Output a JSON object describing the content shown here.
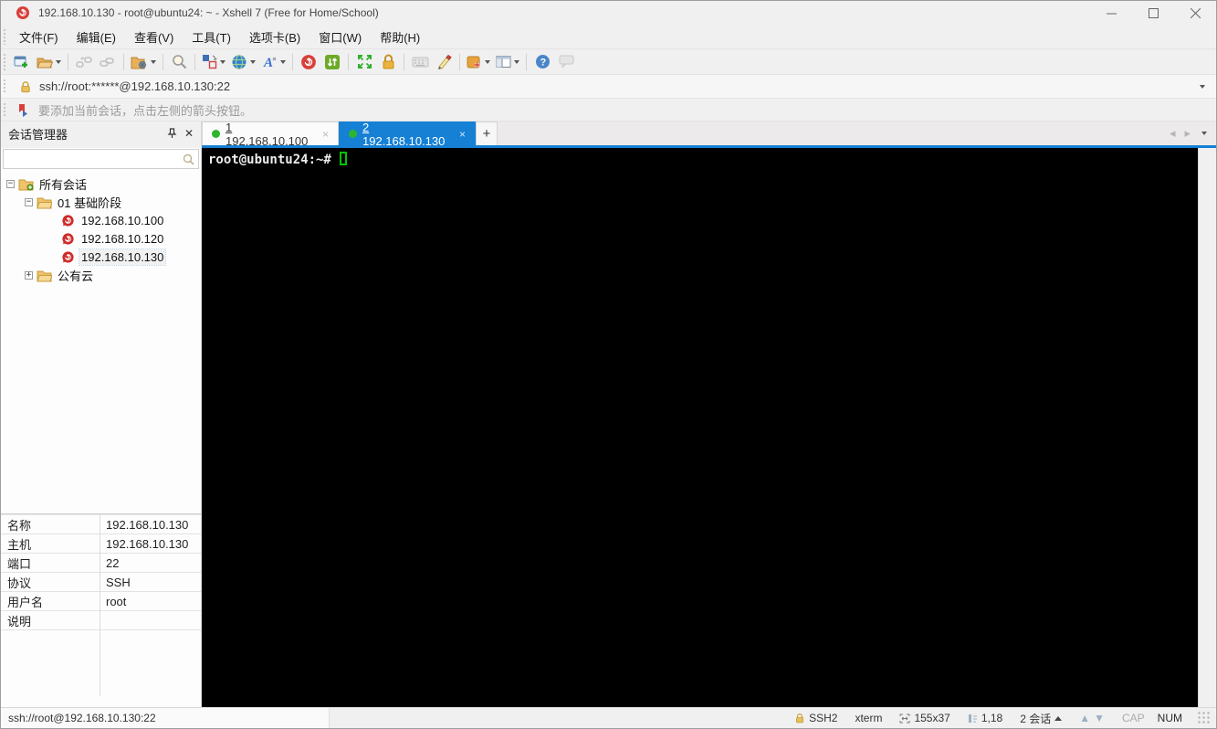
{
  "window": {
    "title": "192.168.10.130 - root@ubuntu24: ~ - Xshell 7 (Free for Home/School)",
    "controls": {
      "minimize": "—",
      "maximize": "□",
      "close": "✕"
    }
  },
  "menu": {
    "items": [
      "文件(F)",
      "编辑(E)",
      "查看(V)",
      "工具(T)",
      "选项卡(B)",
      "窗口(W)",
      "帮助(H)"
    ]
  },
  "toolbar": {
    "icons": [
      "new-session-icon",
      "open-folder-icon",
      "disconnect-icon",
      "reconnect-icon",
      "session-properties-icon",
      "find-icon",
      "arrange-icon",
      "web-browser-icon",
      "font-icon",
      "xshell-app-icon",
      "xftp-app-icon",
      "fullscreen-icon",
      "lock-icon",
      "virtual-keyboard-icon",
      "highlight-pen-icon",
      "new-layout-icon",
      "tile-layout-icon",
      "help-icon",
      "feedback-icon"
    ]
  },
  "address_bar": {
    "value": "ssh://root:******@192.168.10.130:22"
  },
  "info_bar": {
    "text": "要添加当前会话，点击左侧的箭头按钮。"
  },
  "tabs": {
    "items": [
      {
        "index": "1",
        "host": "192.168.10.100",
        "close": "×",
        "active": false
      },
      {
        "index": "2",
        "host": "192.168.10.130",
        "close": "×",
        "active": true
      }
    ],
    "add_label": "+"
  },
  "sidebar": {
    "title": "会话管理器",
    "close": "✕",
    "search": {
      "value": "",
      "placeholder": ""
    },
    "tree": [
      {
        "label": "所有会话",
        "expander": "−",
        "icon": "sessions-root-folder"
      },
      {
        "label": "01 基础阶段",
        "expander": "−",
        "icon": "folder"
      },
      {
        "label": "192.168.10.100",
        "icon": "xshell-session"
      },
      {
        "label": "192.168.10.120",
        "icon": "xshell-session"
      },
      {
        "label": "192.168.10.130",
        "icon": "xshell-session",
        "selected": true
      },
      {
        "label": "公有云",
        "expander": "+",
        "icon": "folder"
      }
    ],
    "properties": [
      {
        "label": "名称",
        "value": "192.168.10.130"
      },
      {
        "label": "主机",
        "value": "192.168.10.130"
      },
      {
        "label": "端口",
        "value": "22"
      },
      {
        "label": "协议",
        "value": "SSH"
      },
      {
        "label": "用户名",
        "value": "root"
      },
      {
        "label": "说明",
        "value": ""
      }
    ]
  },
  "terminal": {
    "prompt": "root@ubuntu24:~#",
    "cursor_style": "hollow-block",
    "cursor_color": "#00c400",
    "background": "#000000"
  },
  "status_bar": {
    "left": "ssh://root@192.168.10.130:22",
    "protocol": "SSH2",
    "terminal_type": "xterm",
    "screen_size": "155x37",
    "cursor_position": "1,18",
    "sessions": "2 会话",
    "caps_lock": "CAP",
    "num_lock": "NUM"
  },
  "colors": {
    "accent_blue": "#1580d4",
    "connected_green": "#2db52d",
    "xshell_red": "#d campagne"
  }
}
